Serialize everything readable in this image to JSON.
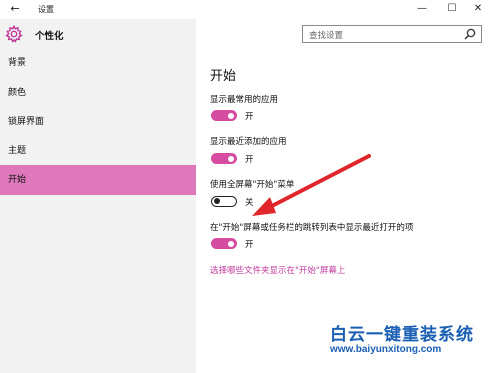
{
  "window": {
    "title": "设置"
  },
  "sidebar": {
    "header_label": "个性化",
    "items": [
      {
        "label": "背景"
      },
      {
        "label": "颜色"
      },
      {
        "label": "锁屏界面"
      },
      {
        "label": "主题"
      },
      {
        "label": "开始",
        "active": true
      }
    ]
  },
  "search": {
    "placeholder": "查找设置"
  },
  "main": {
    "title": "开始",
    "settings": [
      {
        "label": "显示最常用的应用",
        "state": "开",
        "on": true
      },
      {
        "label": "显示最近添加的应用",
        "state": "开",
        "on": true
      },
      {
        "label": "使用全屏幕\"开始\"菜单",
        "state": "关",
        "on": false
      },
      {
        "label": "在\"开始\"屏幕或任务栏的跳转列表中显示最近打开的项",
        "state": "开",
        "on": true
      }
    ],
    "link": "选择哪些文件夹显示在\"开始\"屏幕上"
  },
  "watermark": {
    "title": "白云一键重装系统",
    "url": "www.baiyunxitong.com"
  },
  "colors": {
    "accent": "#de78bb",
    "toggle_on": "#d64ca0",
    "link": "#c2399c",
    "annotation": "#e0262b",
    "watermark": "#1a5fb4"
  }
}
